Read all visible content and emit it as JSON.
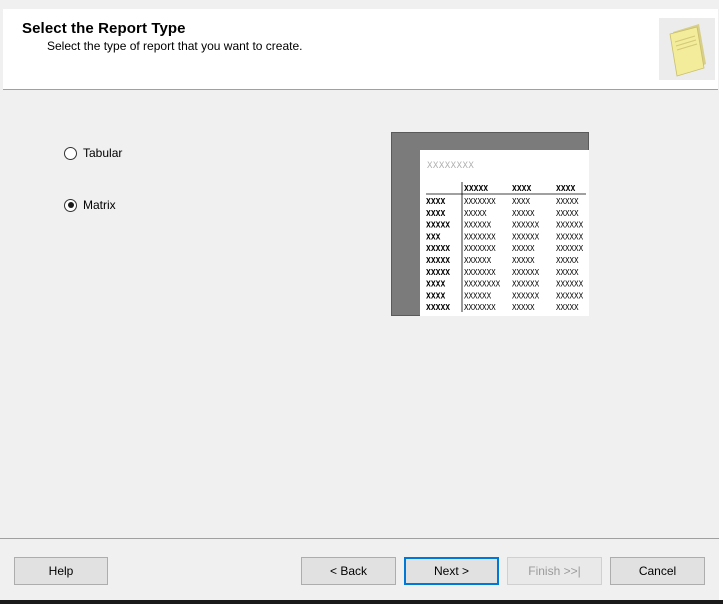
{
  "header": {
    "title": "Select the Report Type",
    "subtitle": "Select the type of report that you want to create."
  },
  "options": [
    {
      "label": "Tabular",
      "checked": false
    },
    {
      "label": "Matrix",
      "checked": true
    }
  ],
  "preview": {
    "title": "XXXXXXXX",
    "column_headers": [
      "XXXXX",
      "XXXX",
      "XXXX"
    ],
    "row_headers": [
      "XXXX",
      "XXXX",
      "XXXXX",
      "XXX",
      "XXXXX",
      "XXXXX",
      "XXXXX",
      "XXXX",
      "XXXX",
      "XXXXX"
    ],
    "cells": [
      [
        "XXXXXXX",
        "XXXX",
        "XXXXX"
      ],
      [
        "XXXXX",
        "XXXXX",
        "XXXXX"
      ],
      [
        "XXXXXX",
        "XXXXXX",
        "XXXXXX"
      ],
      [
        "XXXXXXX",
        "XXXXXX",
        "XXXXXX"
      ],
      [
        "XXXXXXX",
        "XXXXX",
        "XXXXXX"
      ],
      [
        "XXXXXX",
        "XXXXX",
        "XXXXX"
      ],
      [
        "XXXXXXX",
        "XXXXXX",
        "XXXXX"
      ],
      [
        "XXXXXXXX",
        "XXXXXX",
        "XXXXXX"
      ],
      [
        "XXXXXX",
        "XXXXXX",
        "XXXXXX"
      ],
      [
        "XXXXXXX",
        "XXXXX",
        "XXXXX"
      ]
    ]
  },
  "footer": {
    "help": "Help",
    "back": "< Back",
    "next": "Next >",
    "finish": "Finish >>|",
    "cancel": "Cancel"
  },
  "colors": {
    "accent": "#0078d7",
    "panel": "#f0f0f0"
  }
}
